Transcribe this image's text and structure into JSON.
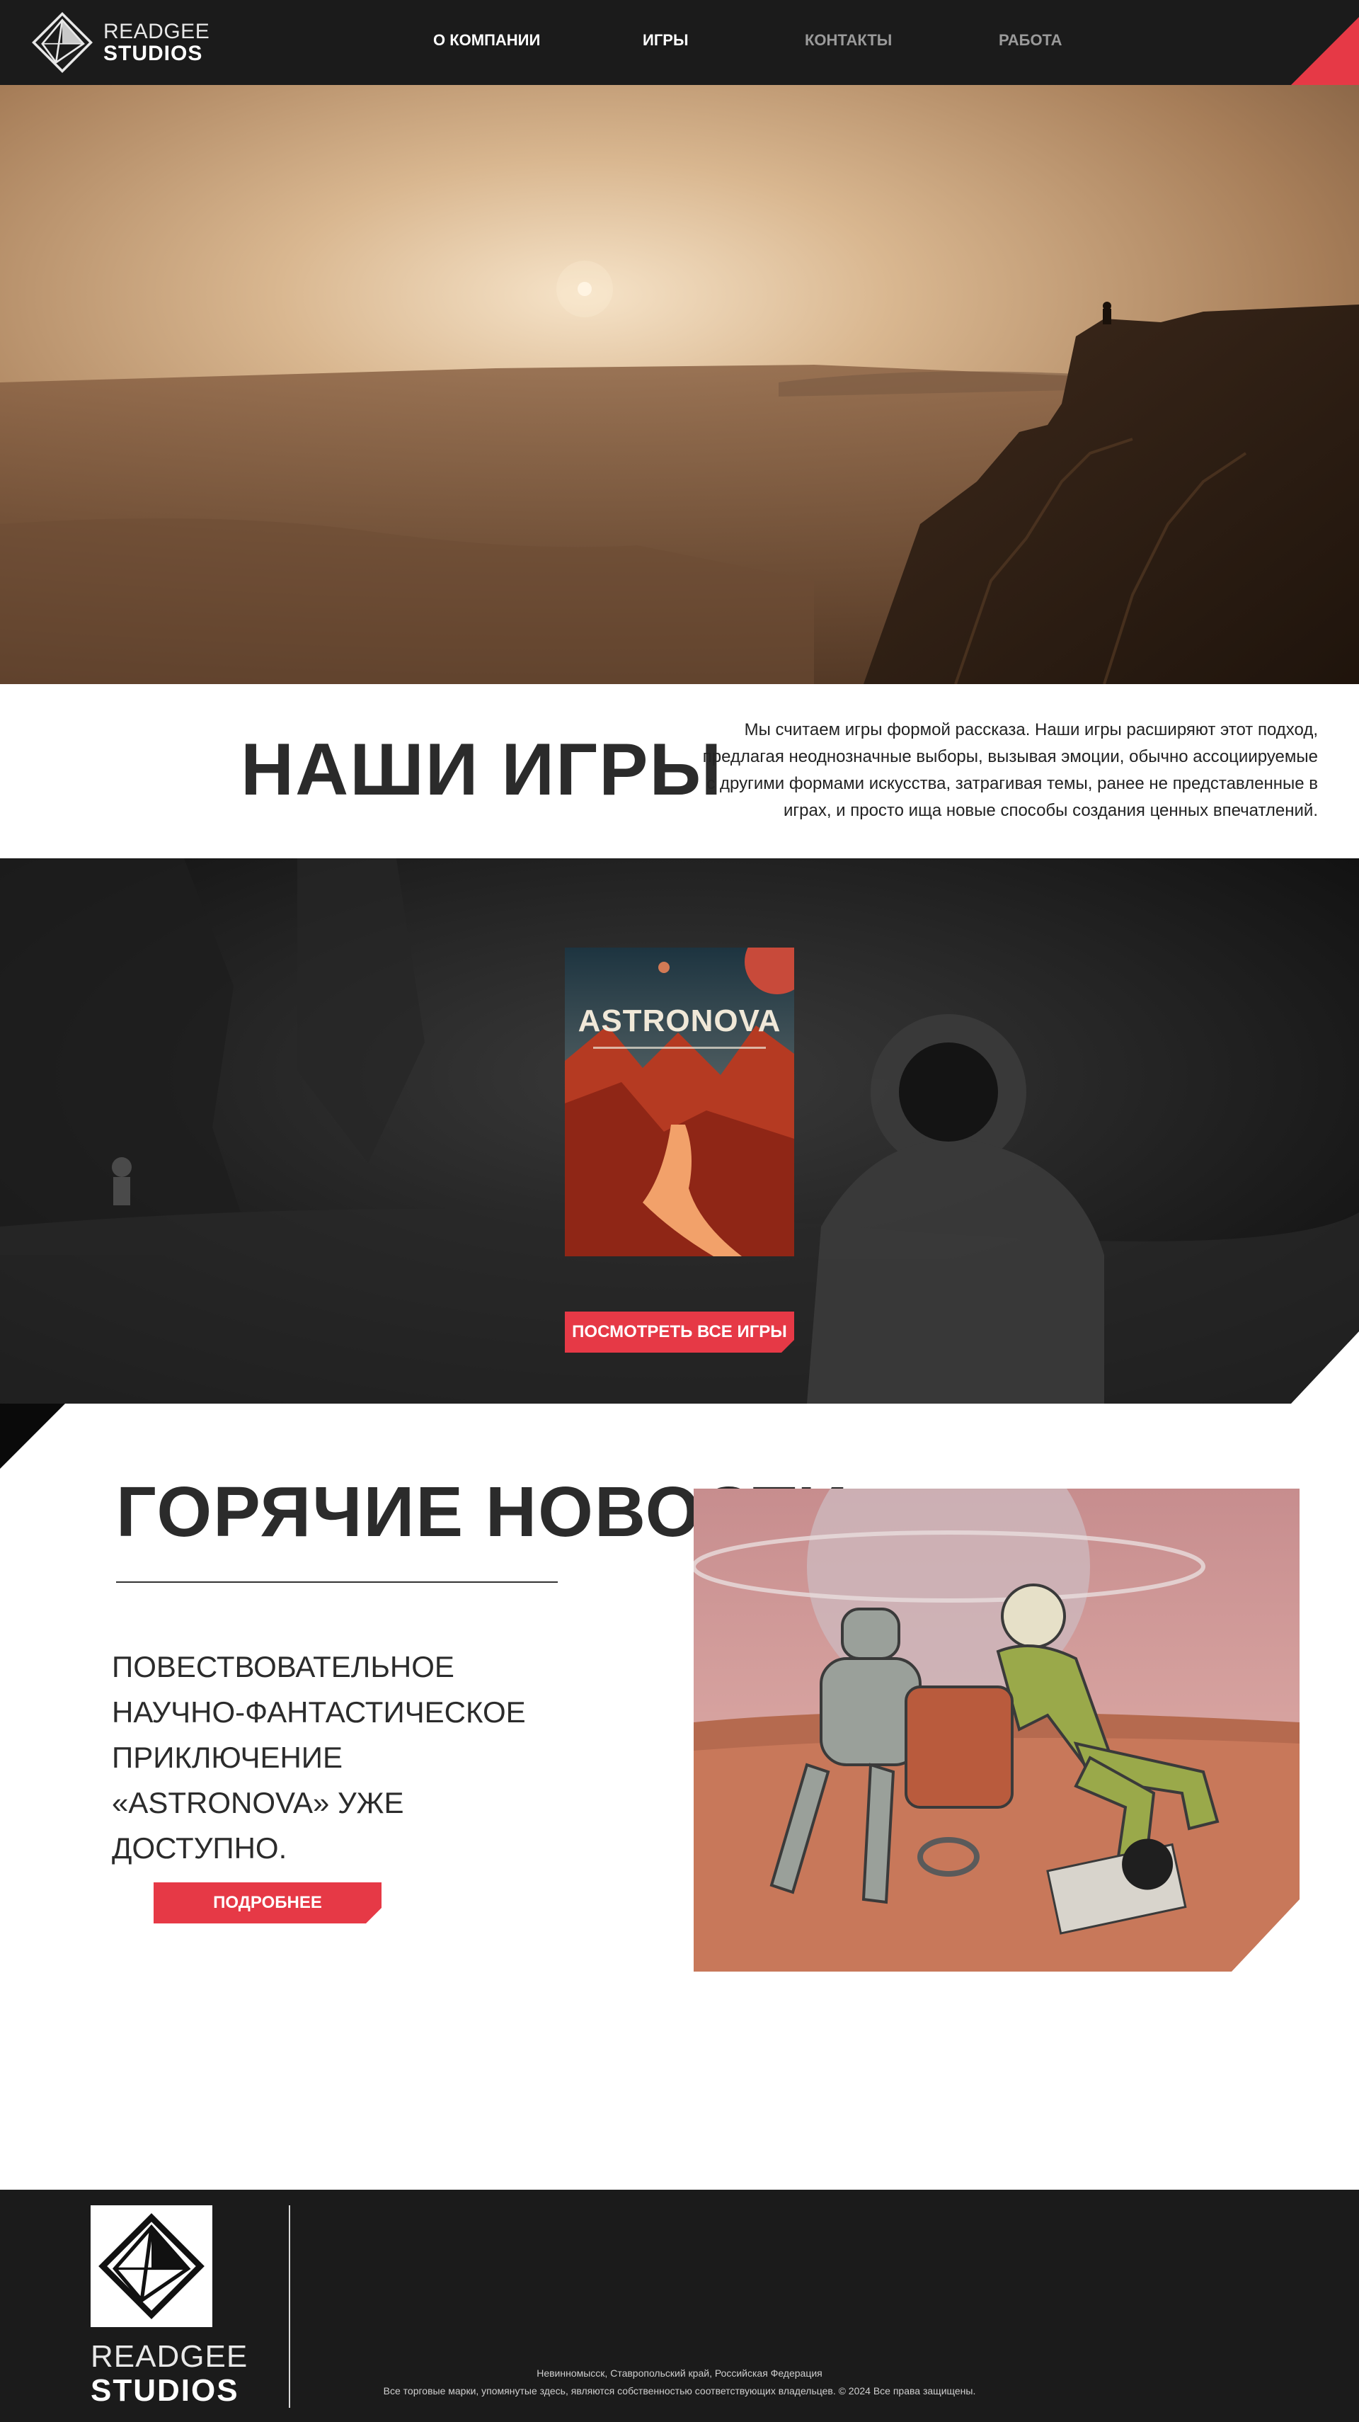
{
  "brand": {
    "line1": "READGEE",
    "line2": "STUDIOS"
  },
  "nav": {
    "items": [
      {
        "label": "О КОМПАНИИ"
      },
      {
        "label": "ИГРЫ"
      },
      {
        "label": "КОНТАКТЫ"
      },
      {
        "label": "РАБОТА"
      }
    ]
  },
  "games": {
    "title": "НАШИ ИГРЫ",
    "description": "Мы считаем игры формой рассказа. Наши игры расширяют этот подход, предлагая неоднозначные выборы, вызывая эмоции, обычно ассоциируемые с другими формами искусства, затрагивая темы, ранее не представленные в играх, и просто ища новые способы создания ценных впечатлений.",
    "cover_title": "ASTRONOVA",
    "all_games_button": "ПОСМОТРЕТЬ ВСЕ ИГРЫ"
  },
  "news": {
    "title": "ГОРЯЧИЕ НОВОСТИ",
    "text": "ПОВЕСТВОВАТЕЛЬНОЕ НАУЧНО-ФАНТАСТИЧЕСКОЕ ПРИКЛЮЧЕНИЕ «ASTRONOVA» УЖЕ ДОСТУПНО.",
    "more_button": "ПОДРОБНЕЕ"
  },
  "footer": {
    "line1": "READGEE",
    "line2": "STUDIOS",
    "address": "Невинномысск, Ставропольский край, Российская Федерация",
    "rights": "Все торговые марки, упомянутые здесь, являются собственностью соответствующих владельцев. © 2024 Все права защищены."
  },
  "colors": {
    "accent": "#e63946",
    "dark": "#1b1b1b",
    "text": "#2b2b2b"
  },
  "icons": [
    "logo-icon"
  ]
}
